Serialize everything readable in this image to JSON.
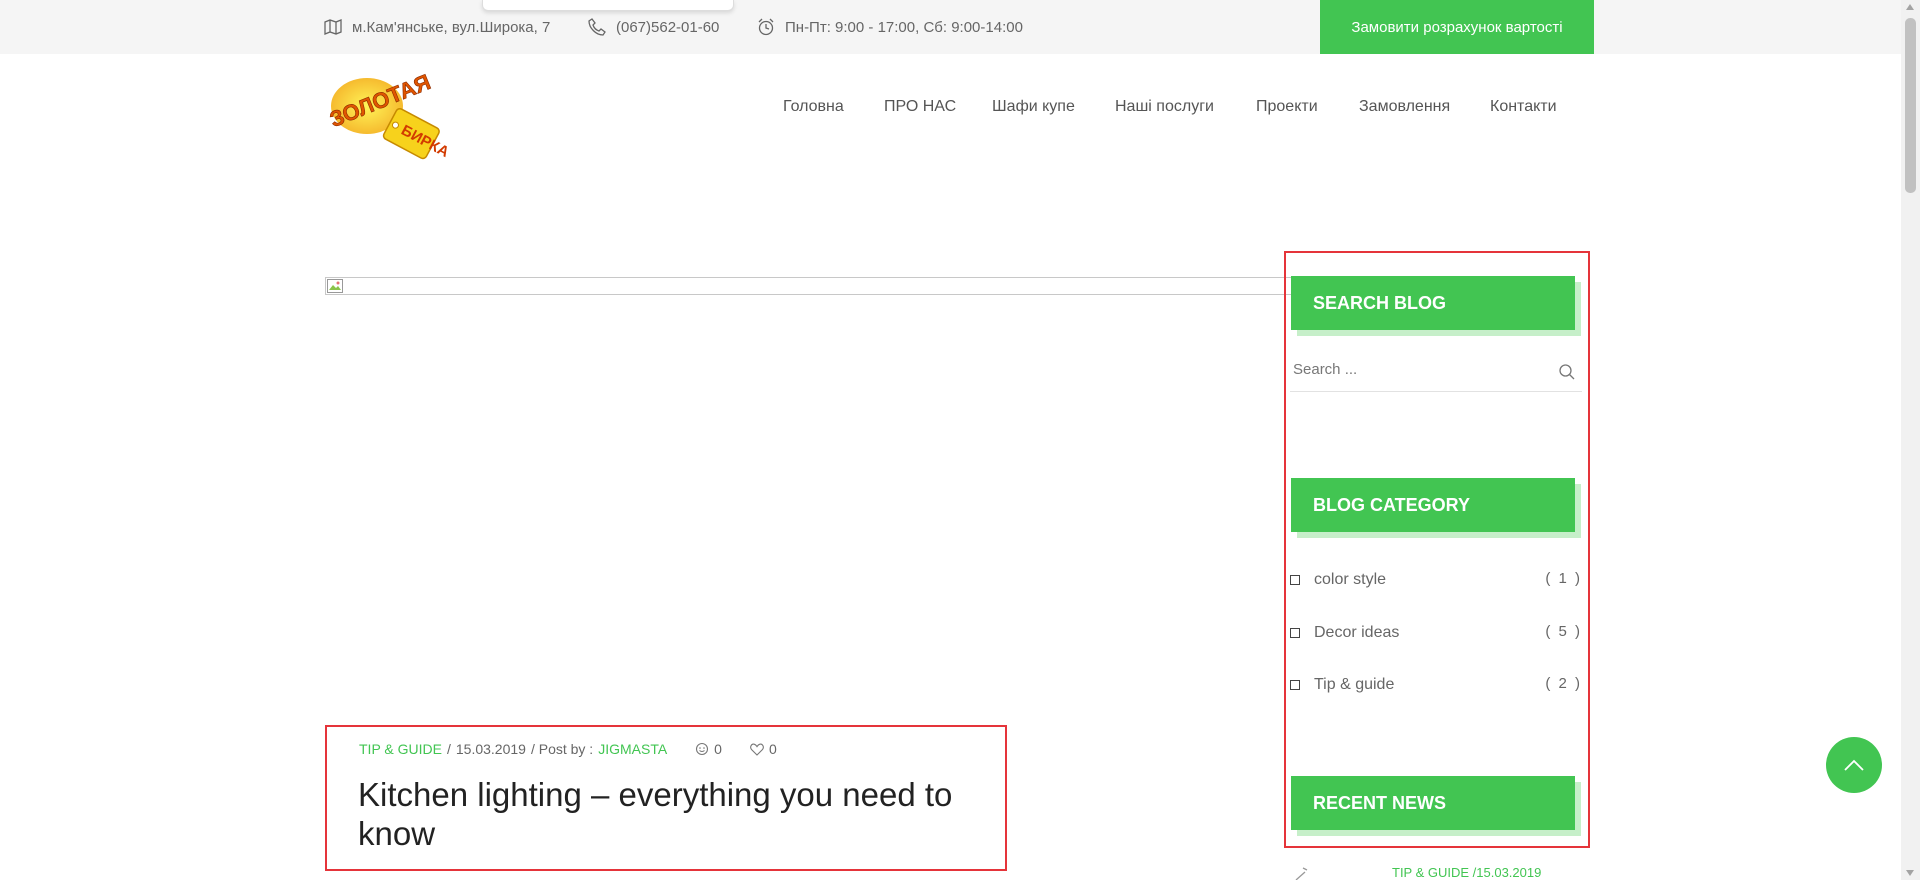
{
  "theme": {
    "accent": "#42c552",
    "highlight": "#e5343a"
  },
  "topbar": {
    "address": {
      "icon": "map-icon",
      "text": "м.Кам'янське, вул.Широка, 7"
    },
    "phone": {
      "icon": "phone-icon",
      "text": "(067)562-01-60"
    },
    "hours": {
      "icon": "clock-icon",
      "text": "Пн-Пт: 9:00 - 17:00, Сб: 9:00-14:00"
    },
    "order_button": "Замовити розрахунок вартості"
  },
  "logo": {
    "line1": "ЗОЛОТАЯ",
    "line2": "БИРКА"
  },
  "nav": {
    "items": [
      {
        "label": "Головна"
      },
      {
        "label": "ПРО НАС"
      },
      {
        "label": "Шафи купе"
      },
      {
        "label": "Наші послуги"
      },
      {
        "label": "Проекти"
      },
      {
        "label": "Замовлення"
      },
      {
        "label": "Контакти"
      }
    ]
  },
  "post": {
    "category": "TIP & GUIDE",
    "separator": "/",
    "date": "15.03.2019",
    "posted_by_label": "/ Post by :",
    "author": "JIGMASTA",
    "comments": "0",
    "likes": "0",
    "title": "Kitchen lighting – everything you need to know"
  },
  "sidebar": {
    "search": {
      "title": "SEARCH BLOG",
      "placeholder": "Search ..."
    },
    "categories": {
      "title": "BLOG CATEGORY",
      "items": [
        {
          "label": "color style",
          "count": "( 1 )"
        },
        {
          "label": "Decor ideas",
          "count": "( 5 )"
        },
        {
          "label": "Tip & guide",
          "count": "( 2 )"
        }
      ]
    },
    "recent": {
      "title": "RECENT NEWS",
      "first_meta": "TIP & GUIDE /15.03.2019"
    }
  }
}
